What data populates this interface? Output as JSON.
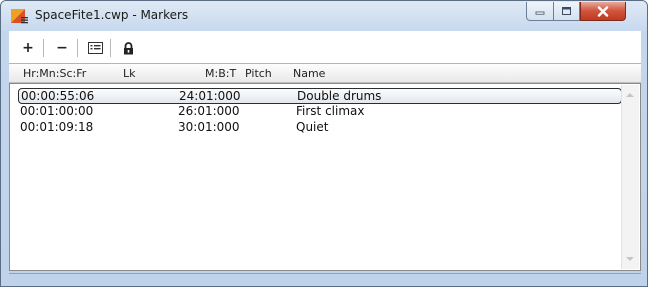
{
  "window": {
    "title": "SpaceFite1.cwp - Markers",
    "icon": "cakewalk-project-icon"
  },
  "controls": {
    "minimize_icon": "minimize-icon",
    "maximize_icon": "maximize-icon",
    "close_icon": "close-icon"
  },
  "toolbar": {
    "add_label": "+",
    "remove_label": "−",
    "properties_icon": "properties-icon",
    "lock_icon": "lock-icon"
  },
  "columns": {
    "time": "Hr:Mn:Sc:Fr",
    "lock": "Lk",
    "mbt": "M:B:T",
    "pitch": "Pitch",
    "name": "Name"
  },
  "markers": [
    {
      "time": "00:00:55:06",
      "mbt": "24:01:000",
      "name": "Double drums",
      "selected": true
    },
    {
      "time": "00:01:00:00",
      "mbt": "26:01:000",
      "name": "First climax",
      "selected": false
    },
    {
      "time": "00:01:09:18",
      "mbt": "30:01:000",
      "name": "Quiet",
      "selected": false
    }
  ],
  "colors": {
    "titlebar": "#c7d9ee",
    "close_button": "#c03a22",
    "selection_border": "#2d2d2d"
  }
}
